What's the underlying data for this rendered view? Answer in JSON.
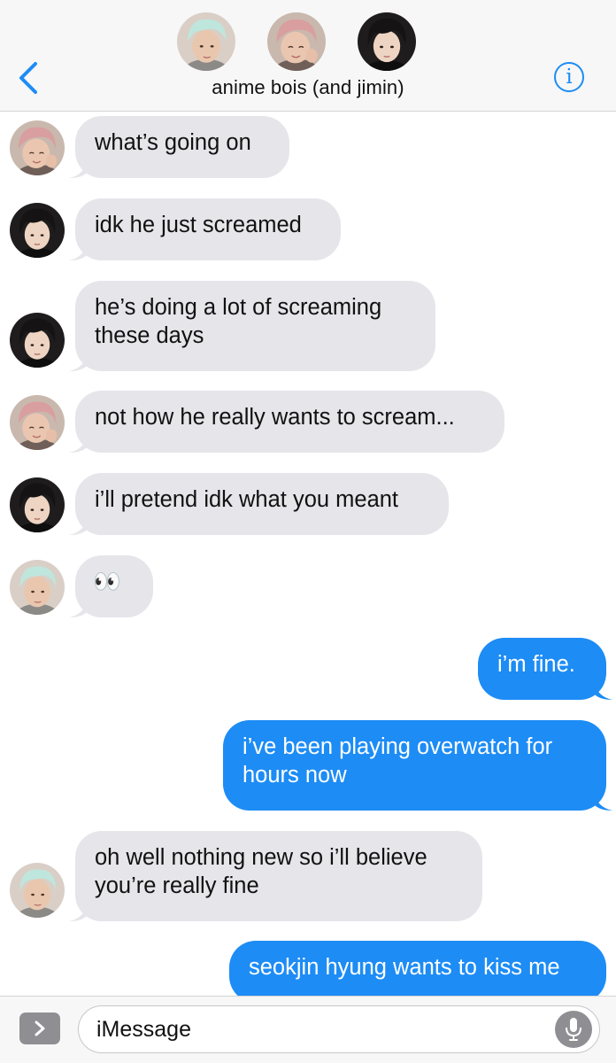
{
  "header": {
    "group_name": "anime bois (and jimin)",
    "participants": [
      {
        "avatar": "avatar-person-1"
      },
      {
        "avatar": "avatar-person-2"
      },
      {
        "avatar": "avatar-person-3"
      }
    ],
    "back_icon": "chevron-left-icon",
    "info_icon": "info-icon",
    "info_label": "i"
  },
  "messages": [
    {
      "direction": "incoming",
      "avatar": "avatar-person-2",
      "text": "what’s going on"
    },
    {
      "direction": "incoming",
      "avatar": "avatar-person-3",
      "text": "idk he just screamed"
    },
    {
      "direction": "incoming",
      "avatar": "avatar-person-3",
      "lines": [
        "he’s doing a lot of screaming",
        "these days"
      ]
    },
    {
      "direction": "incoming",
      "avatar": "avatar-person-2",
      "text": "not how he really wants to scream..."
    },
    {
      "direction": "incoming",
      "avatar": "avatar-person-3",
      "text": "i’ll pretend idk what you meant"
    },
    {
      "direction": "incoming",
      "avatar": "avatar-person-1",
      "text": "👀"
    },
    {
      "direction": "outgoing",
      "text": "i’m fine."
    },
    {
      "direction": "outgoing",
      "lines": [
        "i’ve been playing overwatch for",
        "hours now"
      ]
    },
    {
      "direction": "incoming",
      "avatar": "avatar-person-1",
      "lines": [
        "oh well nothing new so i’ll believe",
        "you’re really fine"
      ]
    },
    {
      "direction": "outgoing",
      "text": "seokjin hyung wants to kiss me"
    }
  ],
  "composer": {
    "placeholder": "iMessage",
    "apps_icon": "chevron-right-icon",
    "mic_icon": "microphone-icon"
  },
  "colors": {
    "outgoing_bubble": "#1d8cf5",
    "incoming_bubble": "#e5e5ea",
    "accent": "#1d8cf5"
  }
}
